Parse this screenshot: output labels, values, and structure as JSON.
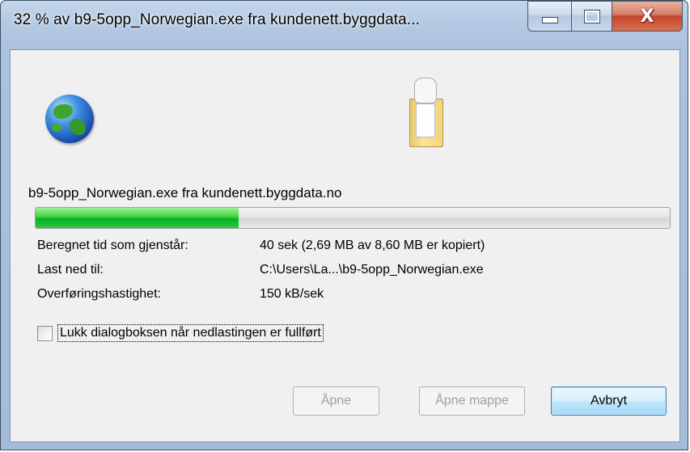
{
  "window": {
    "title": "32 % av b9-5opp_Norwegian.exe fra kundenett.byggdata...",
    "close_symbol": "X"
  },
  "icons": {
    "source": "globe-icon",
    "destination": "folder-icon"
  },
  "download": {
    "filename_line": "b9-5opp_Norwegian.exe fra kundenett.byggdata.no",
    "progress_percent": 32,
    "progress_color": "#06b025"
  },
  "details": [
    {
      "label": "Beregnet tid som gjenstår:",
      "value": "40 sek (2,69 MB av 8,60 MB er kopiert)"
    },
    {
      "label": "Last ned til:",
      "value": "C:\\Users\\La...\\b9-5opp_Norwegian.exe"
    },
    {
      "label": "Overføringshastighet:",
      "value": "150 kB/sek"
    }
  ],
  "close_on_complete": {
    "label": "Lukk dialogboksen når nedlastingen er fullført",
    "checked": false
  },
  "buttons": {
    "open": "Åpne",
    "open_folder": "Åpne mappe",
    "cancel": "Avbryt"
  }
}
